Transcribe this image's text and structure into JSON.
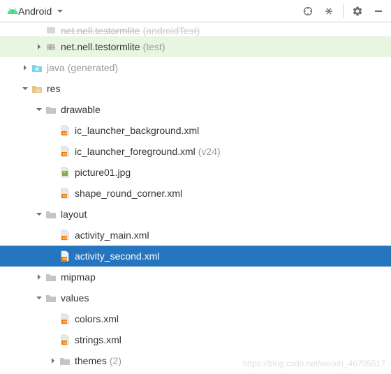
{
  "toolbar": {
    "view_label": "Android"
  },
  "tree": {
    "cut_row": {
      "label_partial": "net.nell.testormlite",
      "qualifier": "(androidTest)"
    },
    "test_pkg": {
      "label": "net.nell.testormlite",
      "qualifier": "(test)"
    },
    "java_gen": {
      "label": "java",
      "qualifier": "(generated)"
    },
    "res": {
      "label": "res"
    },
    "drawable": {
      "label": "drawable"
    },
    "ic_bg": {
      "label": "ic_launcher_background.xml"
    },
    "ic_fg": {
      "label": "ic_launcher_foreground.xml",
      "qualifier": "(v24)"
    },
    "pic": {
      "label": "picture01.jpg"
    },
    "shape": {
      "label": "shape_round_corner.xml"
    },
    "layout": {
      "label": "layout"
    },
    "act_main": {
      "label": "activity_main.xml"
    },
    "act_second": {
      "label": "activity_second.xml"
    },
    "mipmap": {
      "label": "mipmap"
    },
    "values": {
      "label": "values"
    },
    "colors": {
      "label": "colors.xml"
    },
    "strings": {
      "label": "strings.xml"
    },
    "themes": {
      "label": "themes",
      "qualifier": "(2)"
    }
  },
  "watermark": "https://blog.csdn.net/weixin_46705517"
}
